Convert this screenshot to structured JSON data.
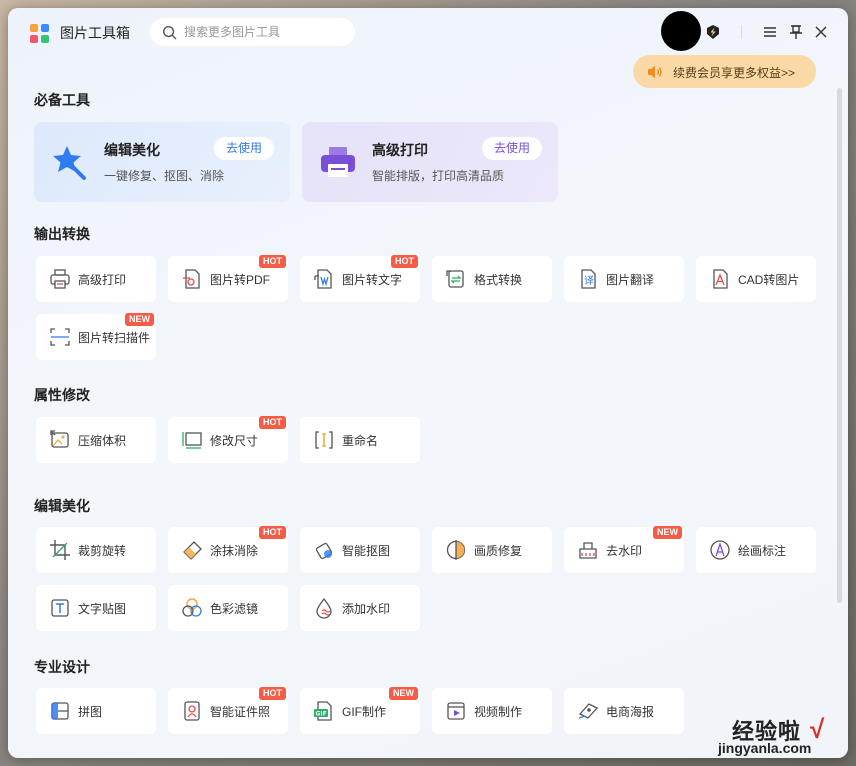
{
  "app": {
    "title": "图片工具箱",
    "search_placeholder": "搜索更多图片工具"
  },
  "vip": {
    "banner_text": "续费会员享更多权益>>"
  },
  "sections": {
    "essential": {
      "title": "必备工具",
      "cards": [
        {
          "title": "编辑美化",
          "desc": "一键修复、抠图、消除",
          "button": "去使用",
          "icon": "magic-wand-icon"
        },
        {
          "title": "高级打印",
          "desc": "智能排版，打印高清品质",
          "button": "去使用",
          "icon": "printer-icon"
        }
      ]
    },
    "output": {
      "title": "输出转换",
      "tools": [
        {
          "label": "高级打印",
          "icon": "printer-icon",
          "tag": ""
        },
        {
          "label": "图片转PDF",
          "icon": "pdf-icon",
          "tag": "HOT"
        },
        {
          "label": "图片转文字",
          "icon": "text-extract-icon",
          "tag": "HOT"
        },
        {
          "label": "格式转换",
          "icon": "format-convert-icon",
          "tag": ""
        },
        {
          "label": "图片翻译",
          "icon": "translate-icon",
          "tag": ""
        },
        {
          "label": "CAD转图片",
          "icon": "cad-icon",
          "tag": ""
        },
        {
          "label": "图片转扫描件",
          "icon": "scan-icon",
          "tag": "NEW"
        }
      ]
    },
    "attributes": {
      "title": "属性修改",
      "tools": [
        {
          "label": "压缩体积",
          "icon": "compress-icon",
          "tag": ""
        },
        {
          "label": "修改尺寸",
          "icon": "resize-icon",
          "tag": "HOT"
        },
        {
          "label": "重命名",
          "icon": "rename-icon",
          "tag": ""
        }
      ]
    },
    "edit": {
      "title": "编辑美化",
      "tools": [
        {
          "label": "裁剪旋转",
          "icon": "crop-icon",
          "tag": ""
        },
        {
          "label": "涂抹消除",
          "icon": "eraser-icon",
          "tag": "HOT"
        },
        {
          "label": "智能抠图",
          "icon": "cutout-icon",
          "tag": ""
        },
        {
          "label": "画质修复",
          "icon": "quality-repair-icon",
          "tag": ""
        },
        {
          "label": "去水印",
          "icon": "remove-watermark-icon",
          "tag": "NEW"
        },
        {
          "label": "绘画标注",
          "icon": "annotate-icon",
          "tag": ""
        },
        {
          "label": "文字贴图",
          "icon": "text-sticker-icon",
          "tag": ""
        },
        {
          "label": "色彩滤镜",
          "icon": "color-filter-icon",
          "tag": ""
        },
        {
          "label": "添加水印",
          "icon": "add-watermark-icon",
          "tag": ""
        }
      ]
    },
    "design": {
      "title": "专业设计",
      "tools": [
        {
          "label": "拼图",
          "icon": "collage-icon",
          "tag": ""
        },
        {
          "label": "智能证件照",
          "icon": "id-photo-icon",
          "tag": "HOT"
        },
        {
          "label": "GIF制作",
          "icon": "gif-icon",
          "tag": "NEW"
        },
        {
          "label": "视频制作",
          "icon": "video-icon",
          "tag": ""
        },
        {
          "label": "电商海报",
          "icon": "poster-icon",
          "tag": ""
        }
      ]
    }
  },
  "watermark": {
    "cn": "经验啦",
    "en": "jingyanla.com",
    "check": "√"
  },
  "colors": {
    "accent_blue": "#2f7bf0",
    "accent_purple": "#7a4fd8",
    "tag_red": "#f45c45",
    "vip_gold": "#fbd9a7"
  }
}
